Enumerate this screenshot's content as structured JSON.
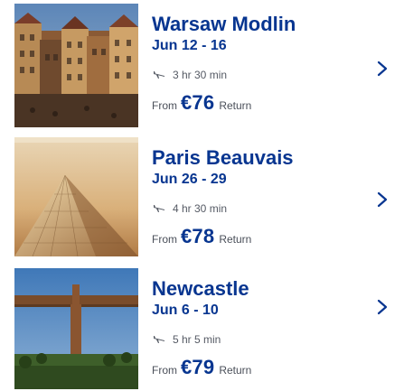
{
  "colors": {
    "accent": "#073590",
    "muted_text": "#4a4f59",
    "chevron": "#073590"
  },
  "destinations": [
    {
      "city": "Warsaw Modlin",
      "dates": "Jun 12 - 16",
      "duration": "3 hr 30 min",
      "from_label": "From",
      "price": "€76",
      "return_label": "Return",
      "thumbnail": "warsaw-old-town-photo"
    },
    {
      "city": "Paris Beauvais",
      "dates": "Jun 26 - 29",
      "duration": "4 hr 30 min",
      "from_label": "From",
      "price": "€78",
      "return_label": "Return",
      "thumbnail": "paris-louvre-pyramid-photo"
    },
    {
      "city": "Newcastle",
      "dates": "Jun 6 - 10",
      "duration": "5 hr 5 min",
      "from_label": "From",
      "price": "€79",
      "return_label": "Return",
      "thumbnail": "newcastle-angel-of-the-north-photo"
    }
  ],
  "icons": {
    "duration": "plane-icon",
    "open": "chevron-right-icon"
  }
}
